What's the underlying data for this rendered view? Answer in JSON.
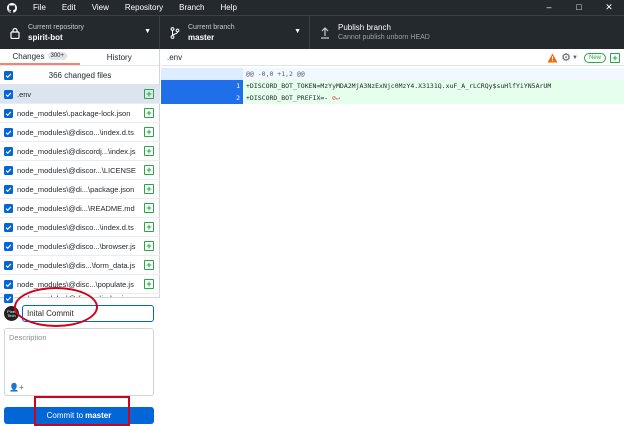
{
  "menu": [
    "File",
    "Edit",
    "View",
    "Repository",
    "Branch",
    "Help"
  ],
  "toolbar": {
    "repo_label": "Current repository",
    "repo_value": "spirit-bot",
    "branch_label": "Current branch",
    "branch_value": "master",
    "publish_label": "Publish branch",
    "publish_sub": "Cannot publish unborn HEAD"
  },
  "tabs": {
    "changes": "Changes",
    "changes_count": "300+",
    "history": "History"
  },
  "changed_files_label": "366 changed files",
  "files": [
    ".env",
    "node_modules\\.package-lock.json",
    "node_modules\\@disco...\\index.d.ts",
    "node_modules\\@discordj...\\index.js",
    "node_modules\\@discor...\\LICENSE",
    "node_modules\\@di...\\package.json",
    "node_modules\\@di...\\README.md",
    "node_modules\\@disco...\\index.d.ts",
    "node_modules\\@disco...\\browser.js",
    "node_modules\\@dis...\\form_data.js",
    "node_modules\\@disc...\\populate.js",
    "node_modules\\@disco...\\index.js"
  ],
  "commit": {
    "summary_value": "Inital Commit",
    "description_placeholder": "Description",
    "button_prefix": "Commit to",
    "button_branch": "master",
    "avatar_text": "Pixel Tech"
  },
  "diff": {
    "path": ".env",
    "new_badge": "New",
    "hunk": "@@ -0,0 +1,2 @@",
    "lines": [
      {
        "num": "1",
        "text": "+DISCORD_BOT_TOKEN=MzYyMDA2MjA3NzExNjc0MzY4.X3131Q.xuF_A_rLCRQy$suHlfYiYN5ArUM"
      },
      {
        "num": "2",
        "text": "+DISCORD_BOT_PREFIX=- "
      }
    ]
  },
  "colors": {
    "accent": "#0366d6",
    "chrome": "#24292e",
    "added_bg": "#e6ffed",
    "annotation": "#d0021b"
  }
}
